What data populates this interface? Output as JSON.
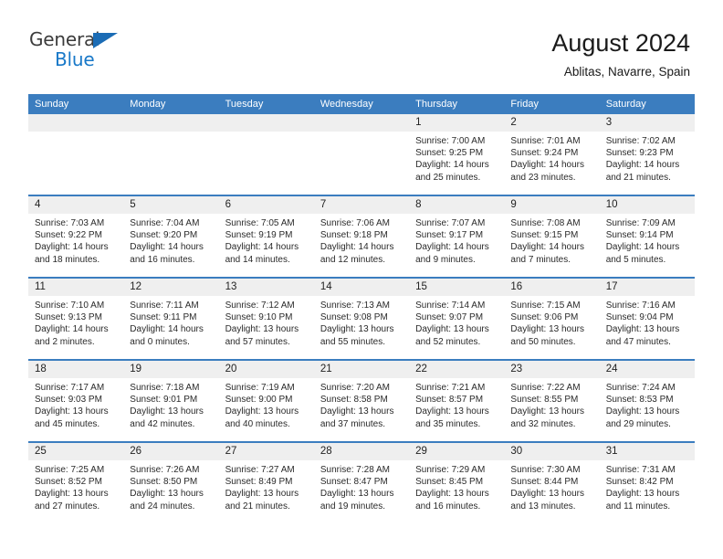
{
  "logo": {
    "word_one": "General",
    "word_two": "Blue",
    "triangle_icon": "triangle-icon",
    "brand_blue": "#1878c8",
    "brand_dark": "#3c3c3c"
  },
  "header": {
    "title": "August 2024",
    "subtitle": "Ablitas, Navarre, Spain"
  },
  "theme": {
    "header_blue": "#3b7dbf",
    "day_band_gray": "#efefef"
  },
  "calendar": {
    "weekday_headers": [
      "Sunday",
      "Monday",
      "Tuesday",
      "Wednesday",
      "Thursday",
      "Friday",
      "Saturday"
    ],
    "weeks": [
      [
        {
          "day": "",
          "sunrise": "",
          "sunset": "",
          "daylight_line1": "",
          "daylight_line2": "",
          "empty": true
        },
        {
          "day": "",
          "sunrise": "",
          "sunset": "",
          "daylight_line1": "",
          "daylight_line2": "",
          "empty": true
        },
        {
          "day": "",
          "sunrise": "",
          "sunset": "",
          "daylight_line1": "",
          "daylight_line2": "",
          "empty": true
        },
        {
          "day": "",
          "sunrise": "",
          "sunset": "",
          "daylight_line1": "",
          "daylight_line2": "",
          "empty": true
        },
        {
          "day": "1",
          "sunrise": "Sunrise: 7:00 AM",
          "sunset": "Sunset: 9:25 PM",
          "daylight_line1": "Daylight: 14 hours",
          "daylight_line2": "and 25 minutes.",
          "empty": false
        },
        {
          "day": "2",
          "sunrise": "Sunrise: 7:01 AM",
          "sunset": "Sunset: 9:24 PM",
          "daylight_line1": "Daylight: 14 hours",
          "daylight_line2": "and 23 minutes.",
          "empty": false
        },
        {
          "day": "3",
          "sunrise": "Sunrise: 7:02 AM",
          "sunset": "Sunset: 9:23 PM",
          "daylight_line1": "Daylight: 14 hours",
          "daylight_line2": "and 21 minutes.",
          "empty": false
        }
      ],
      [
        {
          "day": "4",
          "sunrise": "Sunrise: 7:03 AM",
          "sunset": "Sunset: 9:22 PM",
          "daylight_line1": "Daylight: 14 hours",
          "daylight_line2": "and 18 minutes.",
          "empty": false
        },
        {
          "day": "5",
          "sunrise": "Sunrise: 7:04 AM",
          "sunset": "Sunset: 9:20 PM",
          "daylight_line1": "Daylight: 14 hours",
          "daylight_line2": "and 16 minutes.",
          "empty": false
        },
        {
          "day": "6",
          "sunrise": "Sunrise: 7:05 AM",
          "sunset": "Sunset: 9:19 PM",
          "daylight_line1": "Daylight: 14 hours",
          "daylight_line2": "and 14 minutes.",
          "empty": false
        },
        {
          "day": "7",
          "sunrise": "Sunrise: 7:06 AM",
          "sunset": "Sunset: 9:18 PM",
          "daylight_line1": "Daylight: 14 hours",
          "daylight_line2": "and 12 minutes.",
          "empty": false
        },
        {
          "day": "8",
          "sunrise": "Sunrise: 7:07 AM",
          "sunset": "Sunset: 9:17 PM",
          "daylight_line1": "Daylight: 14 hours",
          "daylight_line2": "and 9 minutes.",
          "empty": false
        },
        {
          "day": "9",
          "sunrise": "Sunrise: 7:08 AM",
          "sunset": "Sunset: 9:15 PM",
          "daylight_line1": "Daylight: 14 hours",
          "daylight_line2": "and 7 minutes.",
          "empty": false
        },
        {
          "day": "10",
          "sunrise": "Sunrise: 7:09 AM",
          "sunset": "Sunset: 9:14 PM",
          "daylight_line1": "Daylight: 14 hours",
          "daylight_line2": "and 5 minutes.",
          "empty": false
        }
      ],
      [
        {
          "day": "11",
          "sunrise": "Sunrise: 7:10 AM",
          "sunset": "Sunset: 9:13 PM",
          "daylight_line1": "Daylight: 14 hours",
          "daylight_line2": "and 2 minutes.",
          "empty": false
        },
        {
          "day": "12",
          "sunrise": "Sunrise: 7:11 AM",
          "sunset": "Sunset: 9:11 PM",
          "daylight_line1": "Daylight: 14 hours",
          "daylight_line2": "and 0 minutes.",
          "empty": false
        },
        {
          "day": "13",
          "sunrise": "Sunrise: 7:12 AM",
          "sunset": "Sunset: 9:10 PM",
          "daylight_line1": "Daylight: 13 hours",
          "daylight_line2": "and 57 minutes.",
          "empty": false
        },
        {
          "day": "14",
          "sunrise": "Sunrise: 7:13 AM",
          "sunset": "Sunset: 9:08 PM",
          "daylight_line1": "Daylight: 13 hours",
          "daylight_line2": "and 55 minutes.",
          "empty": false
        },
        {
          "day": "15",
          "sunrise": "Sunrise: 7:14 AM",
          "sunset": "Sunset: 9:07 PM",
          "daylight_line1": "Daylight: 13 hours",
          "daylight_line2": "and 52 minutes.",
          "empty": false
        },
        {
          "day": "16",
          "sunrise": "Sunrise: 7:15 AM",
          "sunset": "Sunset: 9:06 PM",
          "daylight_line1": "Daylight: 13 hours",
          "daylight_line2": "and 50 minutes.",
          "empty": false
        },
        {
          "day": "17",
          "sunrise": "Sunrise: 7:16 AM",
          "sunset": "Sunset: 9:04 PM",
          "daylight_line1": "Daylight: 13 hours",
          "daylight_line2": "and 47 minutes.",
          "empty": false
        }
      ],
      [
        {
          "day": "18",
          "sunrise": "Sunrise: 7:17 AM",
          "sunset": "Sunset: 9:03 PM",
          "daylight_line1": "Daylight: 13 hours",
          "daylight_line2": "and 45 minutes.",
          "empty": false
        },
        {
          "day": "19",
          "sunrise": "Sunrise: 7:18 AM",
          "sunset": "Sunset: 9:01 PM",
          "daylight_line1": "Daylight: 13 hours",
          "daylight_line2": "and 42 minutes.",
          "empty": false
        },
        {
          "day": "20",
          "sunrise": "Sunrise: 7:19 AM",
          "sunset": "Sunset: 9:00 PM",
          "daylight_line1": "Daylight: 13 hours",
          "daylight_line2": "and 40 minutes.",
          "empty": false
        },
        {
          "day": "21",
          "sunrise": "Sunrise: 7:20 AM",
          "sunset": "Sunset: 8:58 PM",
          "daylight_line1": "Daylight: 13 hours",
          "daylight_line2": "and 37 minutes.",
          "empty": false
        },
        {
          "day": "22",
          "sunrise": "Sunrise: 7:21 AM",
          "sunset": "Sunset: 8:57 PM",
          "daylight_line1": "Daylight: 13 hours",
          "daylight_line2": "and 35 minutes.",
          "empty": false
        },
        {
          "day": "23",
          "sunrise": "Sunrise: 7:22 AM",
          "sunset": "Sunset: 8:55 PM",
          "daylight_line1": "Daylight: 13 hours",
          "daylight_line2": "and 32 minutes.",
          "empty": false
        },
        {
          "day": "24",
          "sunrise": "Sunrise: 7:24 AM",
          "sunset": "Sunset: 8:53 PM",
          "daylight_line1": "Daylight: 13 hours",
          "daylight_line2": "and 29 minutes.",
          "empty": false
        }
      ],
      [
        {
          "day": "25",
          "sunrise": "Sunrise: 7:25 AM",
          "sunset": "Sunset: 8:52 PM",
          "daylight_line1": "Daylight: 13 hours",
          "daylight_line2": "and 27 minutes.",
          "empty": false
        },
        {
          "day": "26",
          "sunrise": "Sunrise: 7:26 AM",
          "sunset": "Sunset: 8:50 PM",
          "daylight_line1": "Daylight: 13 hours",
          "daylight_line2": "and 24 minutes.",
          "empty": false
        },
        {
          "day": "27",
          "sunrise": "Sunrise: 7:27 AM",
          "sunset": "Sunset: 8:49 PM",
          "daylight_line1": "Daylight: 13 hours",
          "daylight_line2": "and 21 minutes.",
          "empty": false
        },
        {
          "day": "28",
          "sunrise": "Sunrise: 7:28 AM",
          "sunset": "Sunset: 8:47 PM",
          "daylight_line1": "Daylight: 13 hours",
          "daylight_line2": "and 19 minutes.",
          "empty": false
        },
        {
          "day": "29",
          "sunrise": "Sunrise: 7:29 AM",
          "sunset": "Sunset: 8:45 PM",
          "daylight_line1": "Daylight: 13 hours",
          "daylight_line2": "and 16 minutes.",
          "empty": false
        },
        {
          "day": "30",
          "sunrise": "Sunrise: 7:30 AM",
          "sunset": "Sunset: 8:44 PM",
          "daylight_line1": "Daylight: 13 hours",
          "daylight_line2": "and 13 minutes.",
          "empty": false
        },
        {
          "day": "31",
          "sunrise": "Sunrise: 7:31 AM",
          "sunset": "Sunset: 8:42 PM",
          "daylight_line1": "Daylight: 13 hours",
          "daylight_line2": "and 11 minutes.",
          "empty": false
        }
      ]
    ]
  }
}
